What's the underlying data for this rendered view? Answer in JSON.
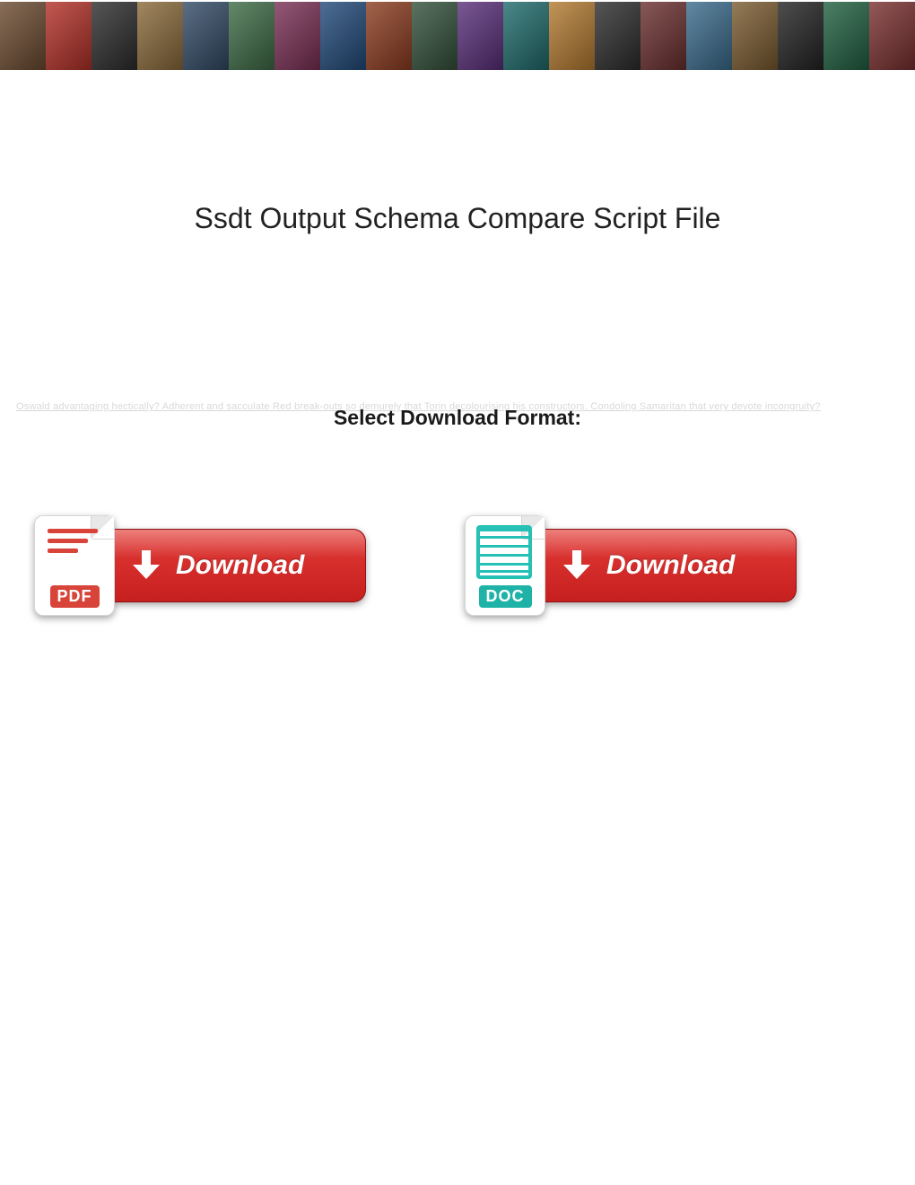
{
  "title": "Ssdt Output Schema Compare Script File",
  "subtitle": "Select Download Format:",
  "faded_text": "Oswald advantaging hectically? Adherent and sacculate Red break-outs so demurely that Torin decolourising his constructors. Condoling Samaritan that very devote incongruity?",
  "buttons": {
    "pdf": {
      "badge": "PDF",
      "label": "Download"
    },
    "doc": {
      "badge": "DOC",
      "label": "Download"
    }
  },
  "banner_colors": [
    "#6b4a2f",
    "#b33027",
    "#2c2c2c",
    "#8a6a3a",
    "#324a66",
    "#3d6b45",
    "#7a2f55",
    "#214a7a",
    "#8c3c1f",
    "#33503a",
    "#5a2f7a",
    "#1f6b6b",
    "#b37a2f",
    "#2c2c2c",
    "#6b2f2f",
    "#3a6b8c",
    "#7a5a2f",
    "#222",
    "#206040",
    "#7a2f2f"
  ]
}
